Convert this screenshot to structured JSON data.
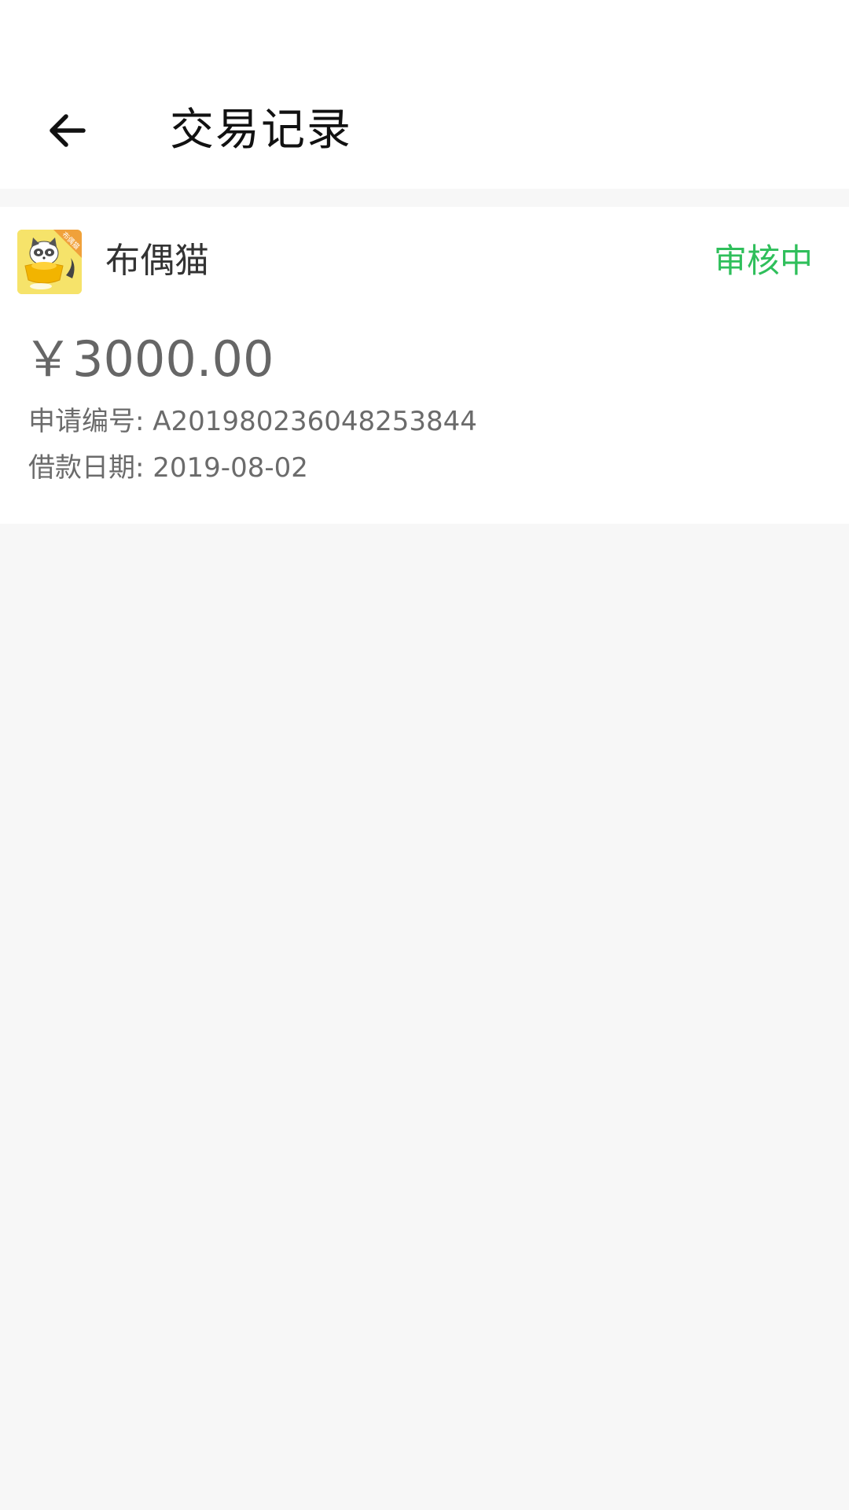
{
  "header": {
    "title": "交易记录",
    "back_icon": "arrow-left-icon"
  },
  "record": {
    "app_name": "布偶猫",
    "logo_badge": "布偶猫",
    "status": "审核中",
    "amount": "￥3000.00",
    "application_label": "申请编号:",
    "application_value": "A201980236048253844",
    "date_label": "借款日期:",
    "date_value": "2019-08-02"
  },
  "colors": {
    "accent_green": "#2fbf5b",
    "logo_yellow": "#f6e36a",
    "logo_orange": "#f0a13a",
    "background": "#f7f7f7",
    "card_bg": "#ffffff"
  }
}
